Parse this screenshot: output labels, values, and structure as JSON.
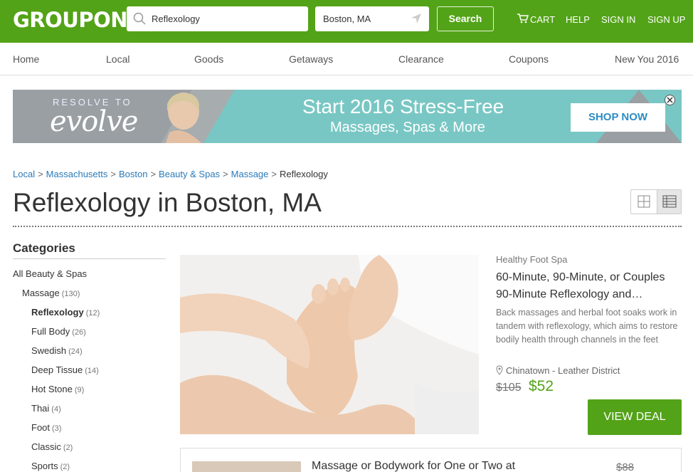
{
  "header": {
    "logo": "GROUPON",
    "search_value": "Reflexology",
    "location_value": "Boston, MA",
    "search_button": "Search",
    "links": {
      "cart": "CART",
      "help": "HELP",
      "sign_in": "SIGN IN",
      "sign_up": "SIGN UP"
    },
    "brand_color": "#53a318"
  },
  "nav": {
    "items": [
      "Home",
      "Local",
      "Goods",
      "Getaways",
      "Clearance",
      "Coupons",
      "New You 2016"
    ]
  },
  "banner": {
    "kicker": "RESOLVE TO",
    "brand": "evolve",
    "headline": "Start 2016 Stress-Free",
    "subline": "Massages, Spas & More",
    "cta": "SHOP NOW"
  },
  "breadcrumb": {
    "items": [
      "Local",
      "Massachusetts",
      "Boston",
      "Beauty & Spas",
      "Massage"
    ],
    "current": "Reflexology",
    "separator": ">"
  },
  "page": {
    "title": "Reflexology in Boston, MA"
  },
  "sidebar": {
    "title": "Categories",
    "items": [
      {
        "label": "All Beauty & Spas",
        "count": ""
      },
      {
        "label": "Massage",
        "count": "(130)"
      },
      {
        "label": "Reflexology",
        "count": "(12)"
      },
      {
        "label": "Full Body",
        "count": "(26)"
      },
      {
        "label": "Swedish",
        "count": "(24)"
      },
      {
        "label": "Deep Tissue",
        "count": "(14)"
      },
      {
        "label": "Hot Stone",
        "count": "(9)"
      },
      {
        "label": "Thai",
        "count": "(4)"
      },
      {
        "label": "Foot",
        "count": "(3)"
      },
      {
        "label": "Classic",
        "count": "(2)"
      },
      {
        "label": "Sports",
        "count": "(2)"
      }
    ]
  },
  "deals": [
    {
      "merchant": "Healthy Foot Spa",
      "title": "60-Minute, 90-Minute, or Couples 90-Minute Reflexology and…",
      "description": "Back massages and herbal foot soaks work in tandem with reflexology, which aims to restore bodily health through channels in the feet",
      "location": "Chinatown - Leather District",
      "old_price": "$105",
      "new_price": "$52",
      "cta": "VIEW DEAL"
    },
    {
      "title": "Massage or Bodywork for One or Two at",
      "old_price": "$88"
    }
  ]
}
